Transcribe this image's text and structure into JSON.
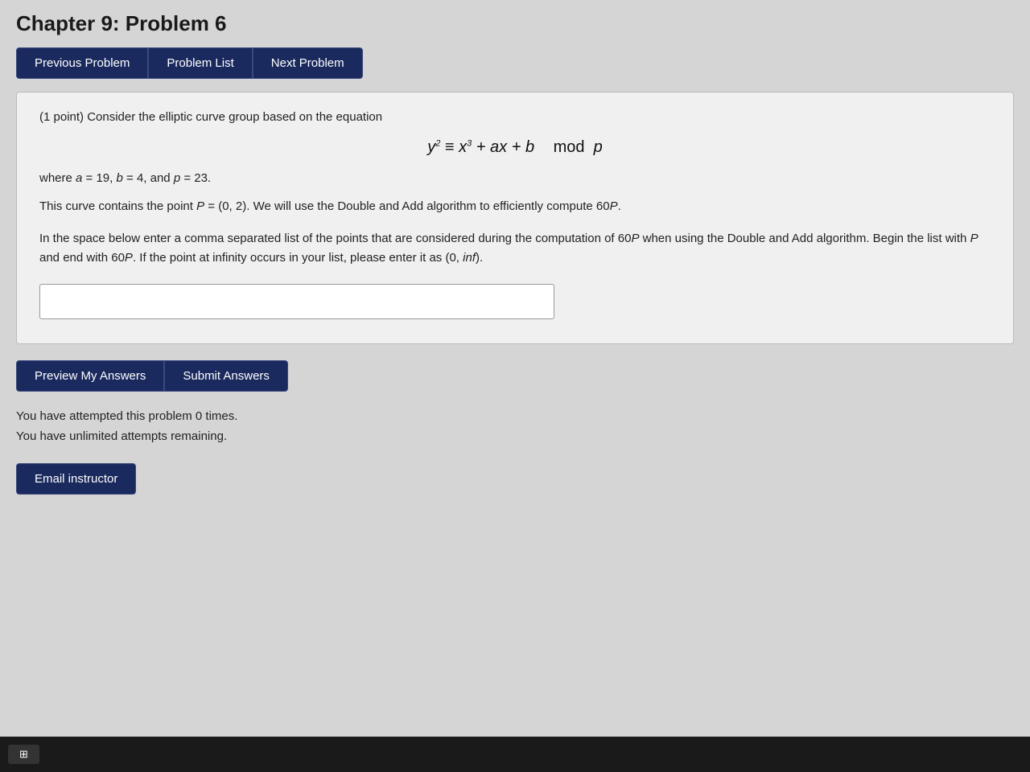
{
  "page": {
    "title": "Chapter 9: Problem 6",
    "nav": {
      "prev_label": "Previous Problem",
      "list_label": "Problem List",
      "next_label": "Next Problem"
    },
    "problem": {
      "points": "(1 point) Consider the elliptic curve group based on the equation",
      "equation_lhs": "y",
      "equation_lhs_exp": "2",
      "equation_equiv": "≡",
      "equation_rhs": "x",
      "equation_rhs_exp": "3",
      "equation_rest": "+ ax + b",
      "equation_mod": "mod",
      "equation_mod_var": "p",
      "params": "where a = 19, b = 4, and p = 23.",
      "curve_point": "This curve contains the point P = (0, 2). We will use the Double and Add algorithm to efficiently compute 60P.",
      "instruction": "In the space below enter a comma separated list of the points that are considered during the computation of 60P when using the Double and Add algorithm. Begin the list with P and end with 60P. If the point at infinity occurs in your list, please enter it as (0, inf).",
      "input_placeholder": ""
    },
    "buttons": {
      "preview_label": "Preview My Answers",
      "submit_label": "Submit Answers",
      "email_label": "Email instructor"
    },
    "attempts": {
      "line1": "You have attempted this problem 0 times.",
      "line2": "You have unlimited attempts remaining."
    }
  }
}
